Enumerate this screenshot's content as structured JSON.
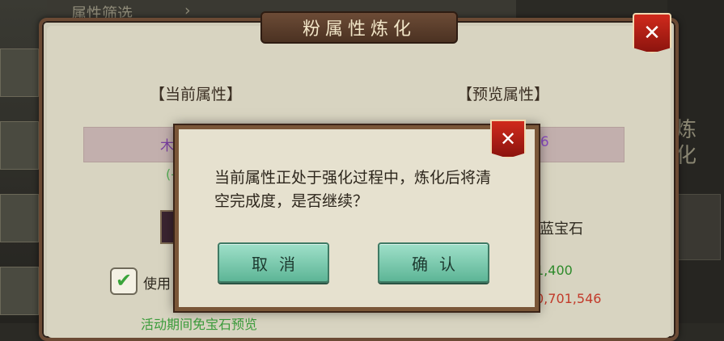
{
  "background": {
    "filter_text": "属性筛选",
    "filter_arrow": "›",
    "right_glyph_1": "炼",
    "right_glyph_2": "化"
  },
  "panel": {
    "title": "粉属性炼化",
    "close_glyph": "✕",
    "current_attr_heading": "【当前属性】",
    "preview_attr_heading": "【预览属性】",
    "current_attr_fragment": "木",
    "preview_attr_fragment": "46",
    "current_attr_paren": "(-",
    "gem_name": "蓝宝石",
    "cost_green": "1,400",
    "cost_red": "0,701,546",
    "use_label": "使用",
    "use_checked": true,
    "promo_text": "活动期间免宝石预览"
  },
  "dialog": {
    "message": "当前属性正处于强化过程中，炼化后将清空完成度，是否继续？",
    "cancel_label": "取消",
    "confirm_label": "确认",
    "close_glyph": "✕"
  },
  "colors": {
    "panel_bg": "#d8d4c1",
    "frame_brown": "#7a5638",
    "close_red": "#c4221a",
    "button_green": "#7fcbb0"
  }
}
